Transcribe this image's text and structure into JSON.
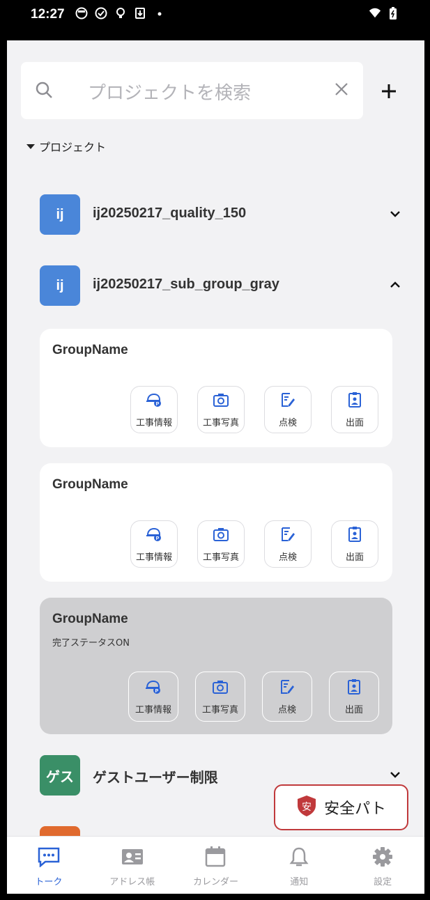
{
  "status_bar": {
    "time": "12:27"
  },
  "search": {
    "placeholder": "プロジェクトを検索"
  },
  "section": {
    "label": "プロジェクト"
  },
  "projects": [
    {
      "avatar": "ij",
      "name": "ij20250217_quality_150",
      "color": "#4a86d9",
      "expanded": false
    },
    {
      "avatar": "ij",
      "name": "ij20250217_sub_group_gray",
      "color": "#4a86d9",
      "expanded": true
    },
    {
      "avatar": "ゲス",
      "name": "ゲストユーザー制限",
      "color": "#3a8f67",
      "expanded": false
    }
  ],
  "groups": [
    {
      "name": "GroupName",
      "status": "",
      "completed": false
    },
    {
      "name": "GroupName",
      "status": "",
      "completed": false
    },
    {
      "name": "GroupName",
      "status": "完了ステータスON",
      "completed": true
    }
  ],
  "tiles": [
    {
      "label": "工事情報",
      "icon": "helmet-icon"
    },
    {
      "label": "工事写真",
      "icon": "camera-icon"
    },
    {
      "label": "点検",
      "icon": "checklist-icon"
    },
    {
      "label": "出面",
      "icon": "attendance-icon"
    }
  ],
  "fab": {
    "label": "安全パト",
    "icon": "safety-shield-icon",
    "color": "#c0393b"
  },
  "nav": [
    {
      "label": "トーク",
      "icon": "chat-icon",
      "active": true
    },
    {
      "label": "アドレス帳",
      "icon": "address-book-icon",
      "active": false
    },
    {
      "label": "カレンダー",
      "icon": "calendar-icon",
      "active": false
    },
    {
      "label": "通知",
      "icon": "bell-icon",
      "active": false
    },
    {
      "label": "設定",
      "icon": "gear-icon",
      "active": false
    }
  ],
  "accent": "#2a62d6"
}
